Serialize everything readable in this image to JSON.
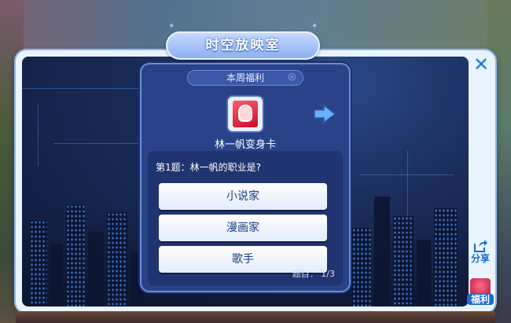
{
  "title": "时空放映室",
  "panel": {
    "header": "本周福利",
    "reward_name": "林一帆变身卡",
    "question": "第1题：林一帆的职业是?",
    "options": [
      "小说家",
      "漫画家",
      "歌手"
    ],
    "progress": "题目：  1/3"
  },
  "side": {
    "share_label": "分享",
    "welfare_label": "福利"
  },
  "icons": {
    "close": "close-icon",
    "share": "share-icon",
    "welfare": "welfare-icon",
    "next": "arrow-right-icon",
    "card": "transform-card-icon"
  },
  "colors": {
    "accent": "#1a78e0",
    "panel_bg": "#2a4288",
    "option_text": "#1a3a7a"
  }
}
